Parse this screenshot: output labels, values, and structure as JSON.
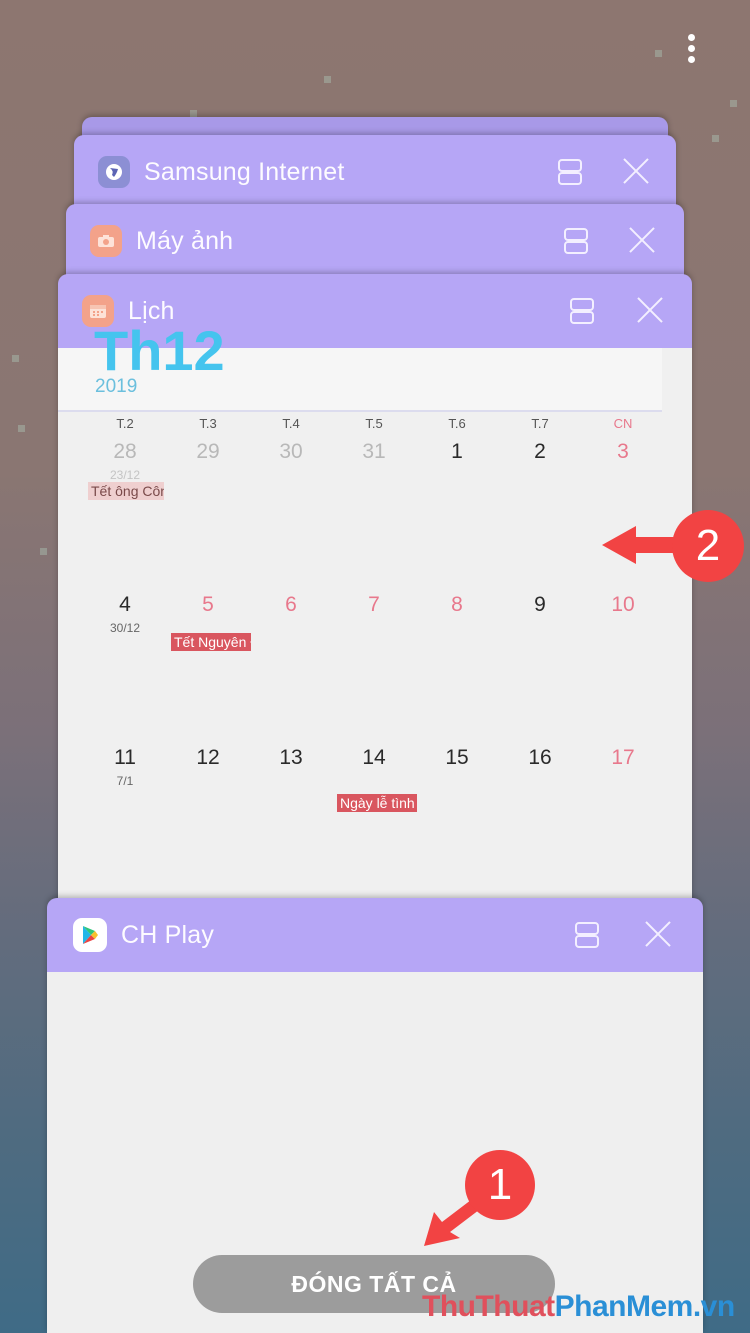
{
  "screen": {
    "more_options_icon": "vertical-ellipsis-icon"
  },
  "recent_apps": [
    {
      "title": "",
      "icon": "blank"
    },
    {
      "title": "Samsung Internet",
      "icon": "globe-icon",
      "icon_color": "#8c8fd4"
    },
    {
      "title": "Máy ảnh",
      "icon": "camera-icon",
      "icon_color": "#f3a28a"
    },
    {
      "title": "Lịch",
      "icon": "calendar-icon",
      "icon_color": "#f3a28a"
    },
    {
      "title": "CH Play",
      "icon": "play-store-icon",
      "icon_color": "#ffffff"
    }
  ],
  "card_actions": {
    "split_screen": "split-screen-icon",
    "close": "close-icon"
  },
  "calendar": {
    "month": "Th12",
    "year": "2019",
    "weekdays": [
      "T.2",
      "T.3",
      "T.4",
      "T.5",
      "T.6",
      "T.7",
      "CN"
    ],
    "weeks": [
      {
        "days": [
          {
            "d": "28",
            "type": "other"
          },
          {
            "d": "29",
            "type": "other"
          },
          {
            "d": "30",
            "type": "other"
          },
          {
            "d": "31",
            "type": "other"
          },
          {
            "d": "1",
            "type": "normal"
          },
          {
            "d": "2",
            "type": "normal"
          },
          {
            "d": "3",
            "type": "holiday"
          }
        ],
        "lunar": [
          {
            "col": 0,
            "text": "23/12"
          }
        ],
        "events": [
          {
            "col": 0,
            "text": "Tết ông Côn",
            "style": "light"
          }
        ]
      },
      {
        "days": [
          {
            "d": "4",
            "type": "normal"
          },
          {
            "d": "5",
            "type": "holiday"
          },
          {
            "d": "6",
            "type": "holiday"
          },
          {
            "d": "7",
            "type": "holiday"
          },
          {
            "d": "8",
            "type": "holiday"
          },
          {
            "d": "9",
            "type": "normal"
          },
          {
            "d": "10",
            "type": "holiday"
          }
        ],
        "lunar": [
          {
            "col": 0,
            "text": "30/12"
          }
        ],
        "events": [
          {
            "col": 1,
            "text": "Tết Nguyên Đ",
            "style": "strong"
          }
        ]
      },
      {
        "days": [
          {
            "d": "11",
            "type": "normal"
          },
          {
            "d": "12",
            "type": "normal"
          },
          {
            "d": "13",
            "type": "normal"
          },
          {
            "d": "14",
            "type": "normal"
          },
          {
            "d": "15",
            "type": "normal"
          },
          {
            "d": "16",
            "type": "normal"
          },
          {
            "d": "17",
            "type": "holiday"
          }
        ],
        "lunar": [
          {
            "col": 0,
            "text": "7/1"
          }
        ],
        "events": [
          {
            "col": 3,
            "text": "Ngày lễ tình",
            "style": "strong"
          }
        ]
      }
    ]
  },
  "close_all_button": "ĐÓNG TẤT CẢ",
  "annotations": [
    {
      "label": "1",
      "target": "close-all-button"
    },
    {
      "label": "2",
      "target": "calendar-card"
    }
  ],
  "watermark": {
    "part1": "ThuThuat",
    "part2": "PhanMem",
    "part3": ".vn"
  },
  "colors": {
    "card_header": "#b6a6f6",
    "holiday_text": "#e8788c",
    "other_month_text": "#b8b8b8",
    "event_strong": "#d9565f",
    "event_light": "#efcfcf",
    "annotation_red": "#f24343",
    "accent_blue": "#45c4ee"
  }
}
